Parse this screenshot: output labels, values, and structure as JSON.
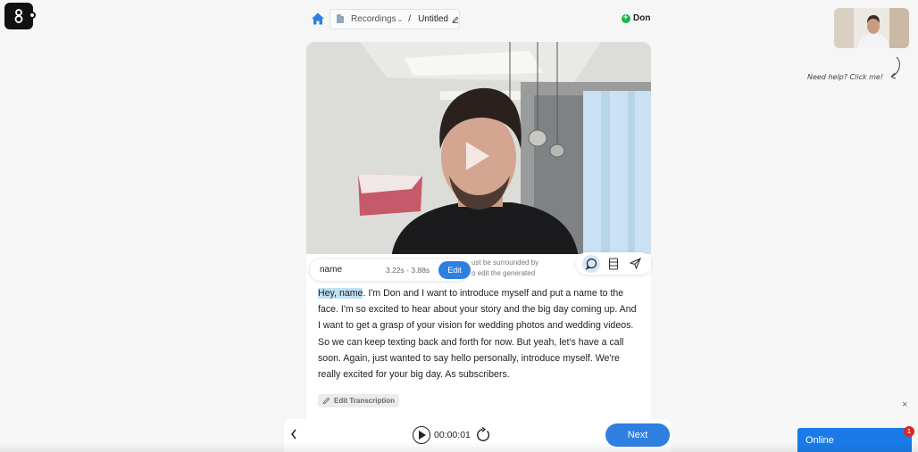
{
  "header": {
    "breadcrumb_root": "Recordings",
    "breadcrumb_caret": "⌄",
    "breadcrumb_separator": "/",
    "breadcrumb_title": "Untitled",
    "user_name": "Don"
  },
  "word_editor": {
    "word": "name",
    "time_range": "3.22s - 3.88s",
    "edit_label": "Edit",
    "hint_line1": "ust be surrounded by",
    "hint_line2": "o edit the generated"
  },
  "transcript": {
    "highlight": "Hey, name",
    "text": ". I'm Don and I want to introduce myself and put a name to the face. I'm so excited to hear about your story and the big day coming up. And I want to get a grasp of your vision for wedding photos and wedding videos. So we can keep texting back and forth for now. But yeah, let's have a call soon. Again, just wanted to say hello personally, introduce myself. We're really excited for your big day. As subscribers.",
    "edit_label": "Edit Transcription"
  },
  "player": {
    "time": "00:00:01",
    "next_label": "Next"
  },
  "help": {
    "text": "Need help? Click me!"
  },
  "chat": {
    "status_label": "Online",
    "badge_count": "1",
    "close_glyph": "×"
  },
  "colors": {
    "accent": "#2e7fe0",
    "highlight": "#bfe1f5",
    "online_green": "#22b04b",
    "chat_blue": "#1a7be8",
    "badge_red": "#e02424"
  }
}
